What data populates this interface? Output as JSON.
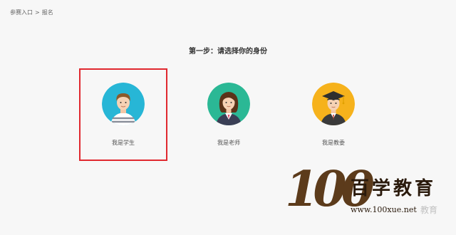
{
  "breadcrumb": {
    "items": [
      "参赛入口",
      "报名"
    ],
    "separator": ">"
  },
  "step": {
    "title": "第一步：请选择你的身份"
  },
  "roles": [
    {
      "label": "我是学生",
      "selected": true,
      "icon": "student-avatar-icon",
      "color": "#27b6d6"
    },
    {
      "label": "我是老师",
      "selected": false,
      "icon": "teacher-avatar-icon",
      "color": "#2bb895"
    },
    {
      "label": "我是教委",
      "selected": false,
      "icon": "official-avatar-icon",
      "color": "#f6b21c"
    }
  ],
  "colors": {
    "selected_border": "#e0282f",
    "background": "#f7f7f7"
  },
  "watermark": {
    "logo_number": "100",
    "logo_text": "百学教育",
    "url": "www.100xue.net",
    "faint_text": "教育"
  }
}
